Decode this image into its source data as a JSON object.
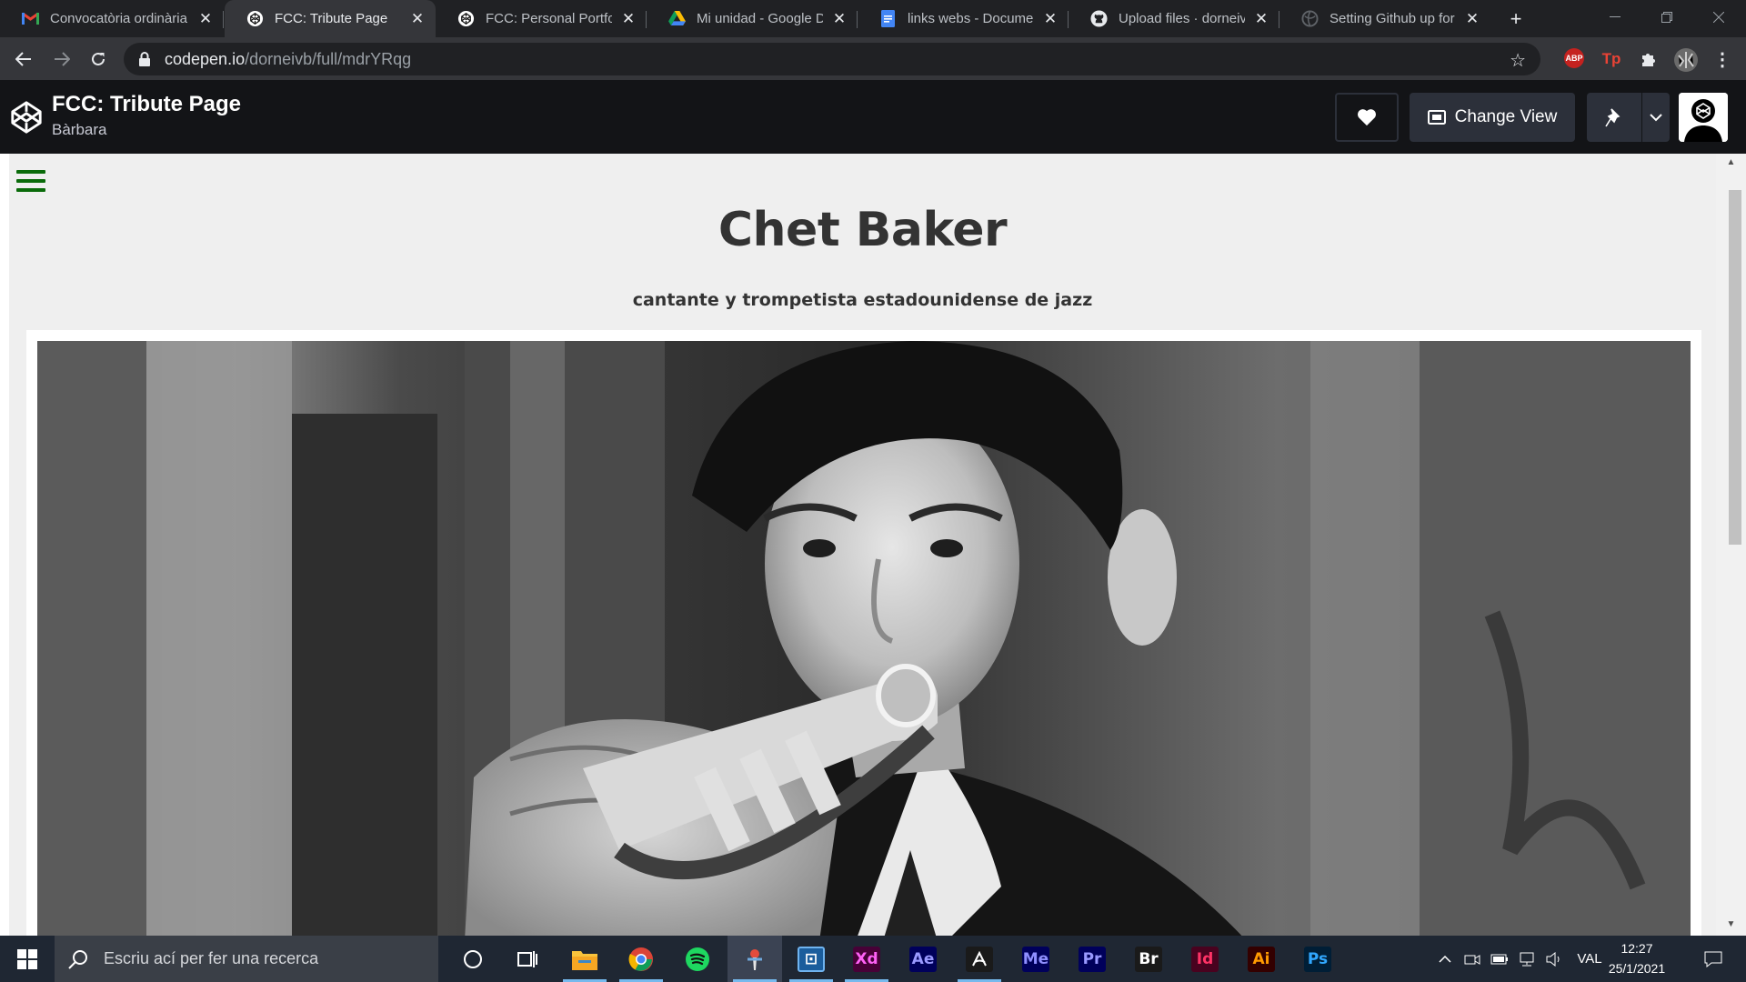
{
  "browser": {
    "tabs": [
      {
        "title": "Convocatòria ordinària",
        "icon": "gmail-icon"
      },
      {
        "title": "FCC: Tribute Page",
        "icon": "codepen-icon",
        "active": true
      },
      {
        "title": "FCC: Personal Portfolio",
        "icon": "codepen-icon"
      },
      {
        "title": "Mi unidad - Google Dr",
        "icon": "google-drive-icon"
      },
      {
        "title": "links webs - Document",
        "icon": "google-docs-icon"
      },
      {
        "title": "Upload files · dorneivb",
        "icon": "github-icon"
      },
      {
        "title": "Setting Github up for (",
        "icon": "globe-icon"
      }
    ],
    "url_host": "codepen.io",
    "url_path": "/dorneivb/full/mdrYRqg",
    "extensions": [
      "ABP",
      "Tp"
    ]
  },
  "codepen": {
    "title": "FCC: Tribute Page",
    "author": "Bàrbara",
    "change_view_label": "Change View"
  },
  "page": {
    "heading": "Chet Baker",
    "subheading": "cantante y trompetista estadounidense de jazz"
  },
  "taskbar": {
    "search_placeholder": "Escriu ací per fer una recerca",
    "apps": [
      "File Explorer",
      "Chrome",
      "Spotify",
      "App",
      "App",
      "Xd",
      "Ae",
      "Acrobat",
      "Me",
      "Pr",
      "Br",
      "Id",
      "Ai",
      "Ps"
    ],
    "language": "VAL",
    "time": "12:27",
    "date": "25/1/2021"
  },
  "colors": {
    "accent_green": "#0a6b0a",
    "codepen_header": "#131417",
    "page_bg": "#efefef"
  }
}
